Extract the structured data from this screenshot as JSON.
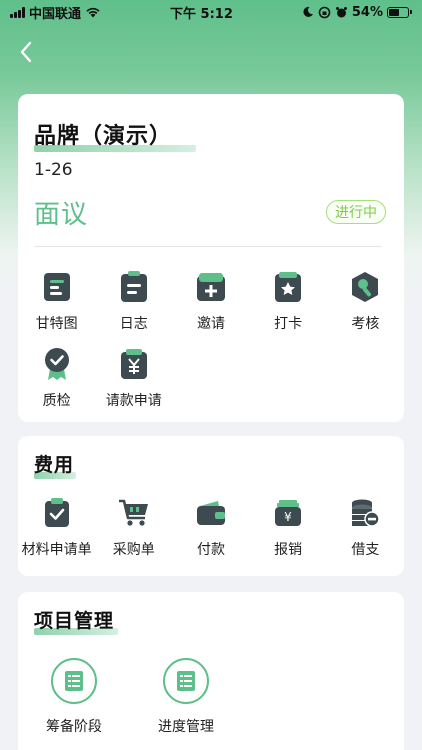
{
  "status_bar": {
    "carrier": "中国联通",
    "time": "下午 5:12",
    "battery": "54%",
    "battery_level": 0.54
  },
  "project": {
    "title": "品牌（演示）",
    "subtitle": "1-26",
    "stage": "面议",
    "status_badge": "进行中"
  },
  "main_tools": [
    {
      "label": "甘特图",
      "icon": "gantt-icon"
    },
    {
      "label": "日志",
      "icon": "log-icon"
    },
    {
      "label": "邀请",
      "icon": "invite-icon"
    },
    {
      "label": "打卡",
      "icon": "checkin-icon"
    },
    {
      "label": "考核",
      "icon": "assess-icon"
    },
    {
      "label": "质检",
      "icon": "quality-icon"
    },
    {
      "label": "请款申请",
      "icon": "payment-request-icon"
    }
  ],
  "fee_section": {
    "title": "费用",
    "items": [
      {
        "label": "材料申请单",
        "icon": "material-request-icon"
      },
      {
        "label": "采购单",
        "icon": "cart-icon"
      },
      {
        "label": "付款",
        "icon": "wallet-icon"
      },
      {
        "label": "报销",
        "icon": "reimburse-icon"
      },
      {
        "label": "借支",
        "icon": "loan-icon"
      }
    ]
  },
  "project_section": {
    "title": "项目管理",
    "items": [
      {
        "label": "筹备阶段",
        "icon": "list-icon"
      },
      {
        "label": "进度管理",
        "icon": "list-icon"
      }
    ]
  },
  "colors": {
    "accent": "#5fbf8a",
    "icon_dark": "#3d4a4f",
    "badge": "#7ecb4a"
  }
}
